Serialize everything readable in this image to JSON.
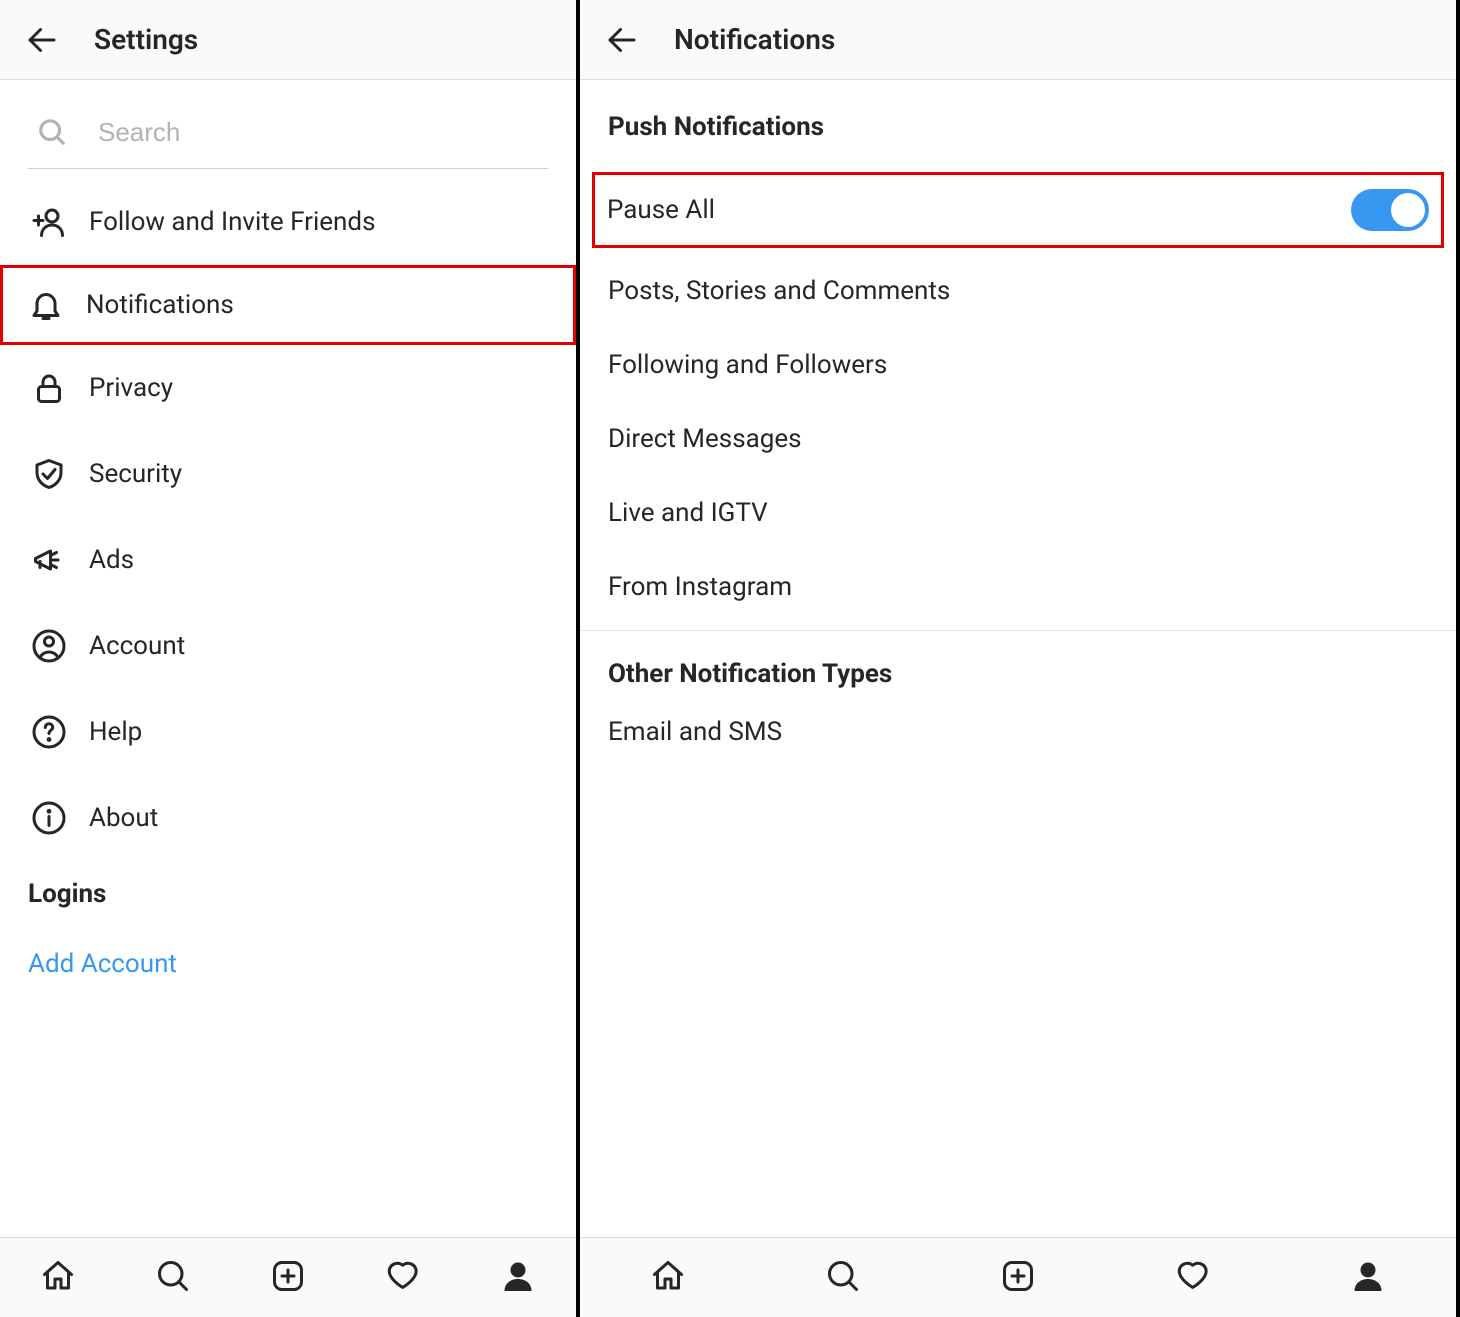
{
  "left": {
    "header": {
      "title": "Settings"
    },
    "search_placeholder": "Search",
    "menu": [
      {
        "key": "follow",
        "label": "Follow and Invite Friends"
      },
      {
        "key": "notifications",
        "label": "Notifications",
        "highlight": true
      },
      {
        "key": "privacy",
        "label": "Privacy"
      },
      {
        "key": "security",
        "label": "Security"
      },
      {
        "key": "ads",
        "label": "Ads"
      },
      {
        "key": "account",
        "label": "Account"
      },
      {
        "key": "help",
        "label": "Help"
      },
      {
        "key": "about",
        "label": "About"
      }
    ],
    "logins_section": "Logins",
    "add_account": "Add Account"
  },
  "right": {
    "header": {
      "title": "Notifications"
    },
    "push_section_title": "Push Notifications",
    "push_items": [
      {
        "key": "pause_all",
        "label": "Pause All",
        "toggle": true,
        "highlight": true
      },
      {
        "key": "posts",
        "label": "Posts, Stories and Comments"
      },
      {
        "key": "following",
        "label": "Following and Followers"
      },
      {
        "key": "direct",
        "label": "Direct Messages"
      },
      {
        "key": "live",
        "label": "Live and IGTV"
      },
      {
        "key": "from_ig",
        "label": "From Instagram"
      }
    ],
    "other_section_title": "Other Notification Types",
    "other_items": [
      {
        "key": "email_sms",
        "label": "Email and SMS"
      }
    ]
  },
  "colors": {
    "toggle_on": "#3897f0",
    "link": "#3897f0",
    "highlight_border": "#e00000"
  }
}
